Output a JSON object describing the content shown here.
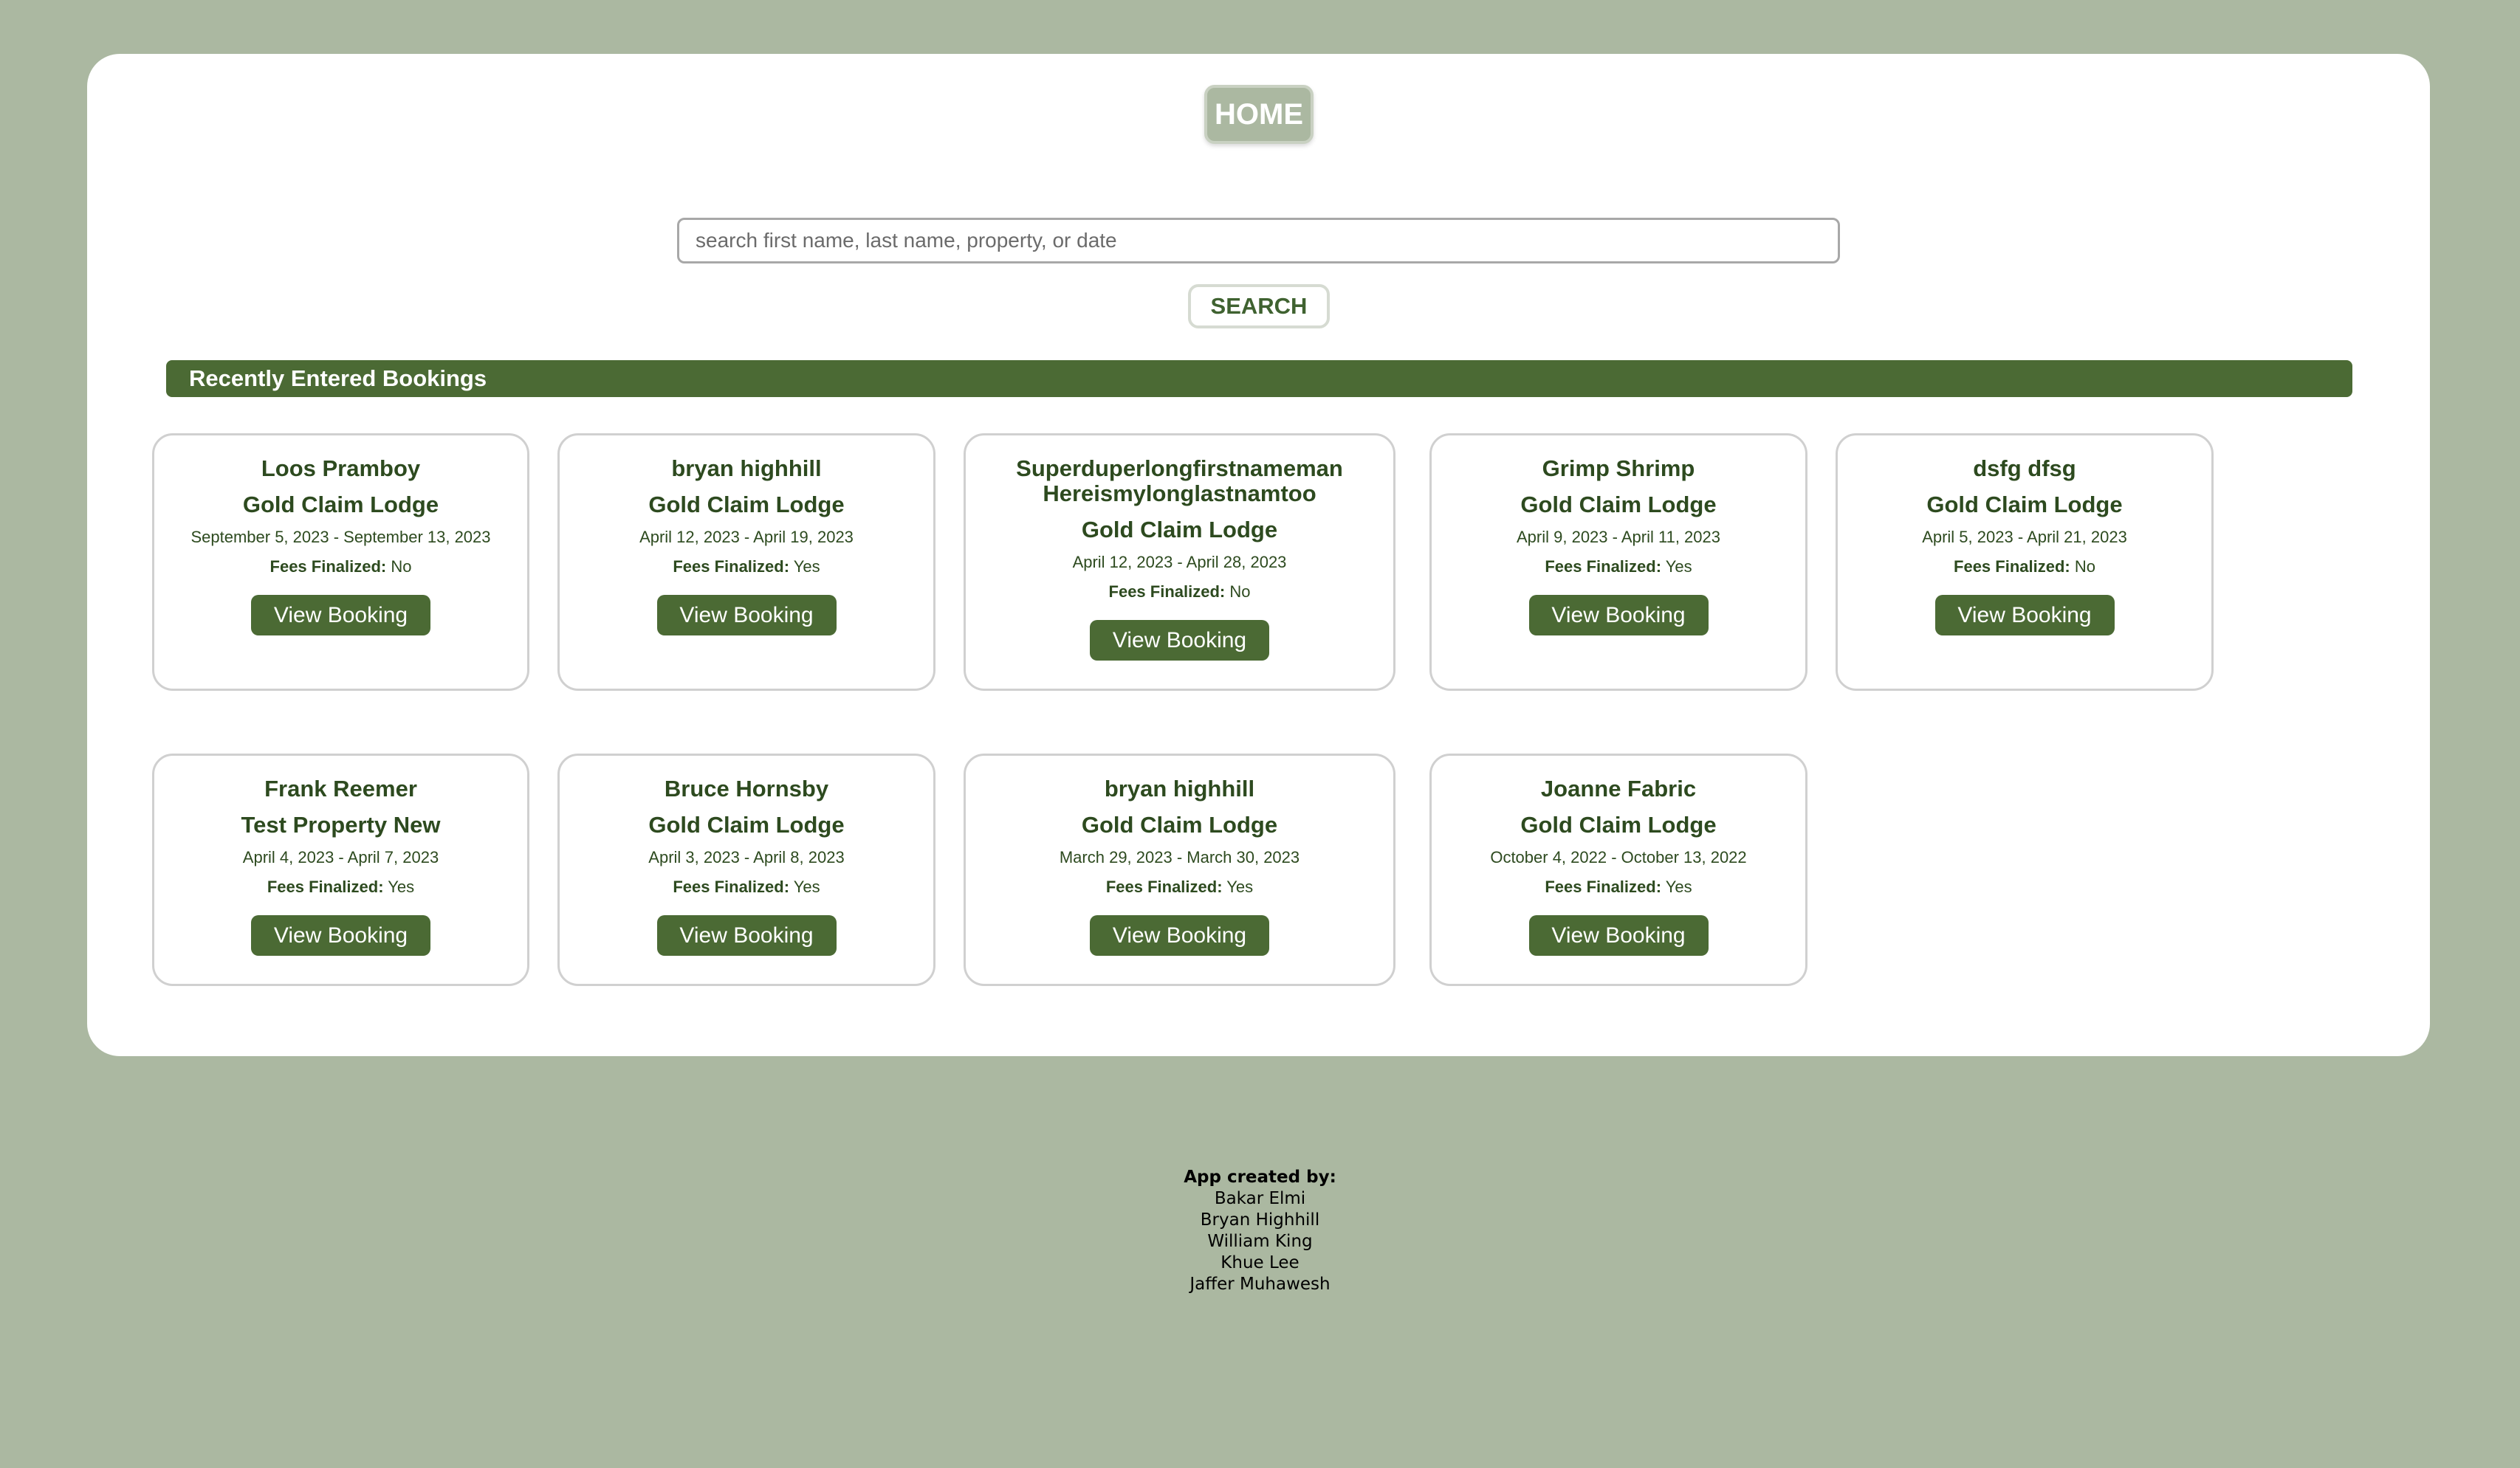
{
  "nav": {
    "home_label": "HOME"
  },
  "search": {
    "placeholder": "search first name, last name, property, or date",
    "value": "",
    "button_label": "SEARCH"
  },
  "section": {
    "title": "Recently Entered Bookings"
  },
  "bookings": [
    {
      "name": "Loos Pramboy",
      "property": "Gold Claim Lodge",
      "dates": "September 5, 2023 - September 13, 2023",
      "fees_label": "Fees Finalized:",
      "fees_value": "No",
      "button_label": "View Booking"
    },
    {
      "name": "bryan highhill",
      "property": "Gold Claim Lodge",
      "dates": "April 12, 2023 - April 19, 2023",
      "fees_label": "Fees Finalized:",
      "fees_value": "Yes",
      "button_label": "View Booking"
    },
    {
      "name_line1": "Superduperlongfirstnameman",
      "name_line2": "Hereismylonglastnamtoo",
      "property": "Gold Claim Lodge",
      "dates": "April 12, 2023 - April 28, 2023",
      "fees_label": "Fees Finalized:",
      "fees_value": "No",
      "button_label": "View Booking"
    },
    {
      "name": "Grimp Shrimp",
      "property": "Gold Claim Lodge",
      "dates": "April 9, 2023 - April 11, 2023",
      "fees_label": "Fees Finalized:",
      "fees_value": "Yes",
      "button_label": "View Booking"
    },
    {
      "name": "dsfg dfsg",
      "property": "Gold Claim Lodge",
      "dates": "April 5, 2023 - April 21, 2023",
      "fees_label": "Fees Finalized:",
      "fees_value": "No",
      "button_label": "View Booking"
    },
    {
      "name": "Frank Reemer",
      "property": "Test Property New",
      "dates": "April 4, 2023 - April 7, 2023",
      "fees_label": "Fees Finalized:",
      "fees_value": "Yes",
      "button_label": "View Booking"
    },
    {
      "name": "Bruce Hornsby",
      "property": "Gold Claim Lodge",
      "dates": "April 3, 2023 - April 8, 2023",
      "fees_label": "Fees Finalized:",
      "fees_value": "Yes",
      "button_label": "View Booking"
    },
    {
      "name": "bryan highhill",
      "property": "Gold Claim Lodge",
      "dates": "March 29, 2023 - March 30, 2023",
      "fees_label": "Fees Finalized:",
      "fees_value": "Yes",
      "button_label": "View Booking"
    },
    {
      "name": "Joanne Fabric",
      "property": "Gold Claim Lodge",
      "dates": "October 4, 2022 - October 13, 2022",
      "fees_label": "Fees Finalized:",
      "fees_value": "Yes",
      "button_label": "View Booking"
    }
  ],
  "footer": {
    "heading": "App created by:",
    "names": [
      "Bakar Elmi",
      "Bryan Highhill",
      "William King",
      "Khue Lee",
      "Jaffer Muhawesh"
    ]
  }
}
